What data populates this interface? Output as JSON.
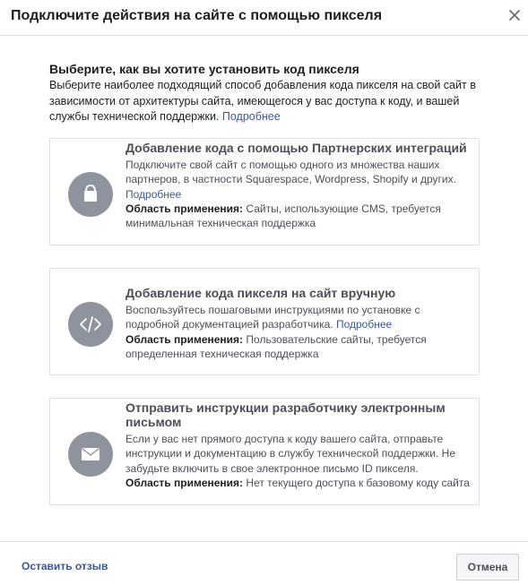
{
  "dialog": {
    "title": "Подключите действия на сайте с помощью пикселя",
    "close_icon": "close-icon"
  },
  "intro": {
    "heading": "Выберите, как вы хотите установить код пикселя",
    "text": "Выберите наиболее подходящий способ добавления кода пикселя на свой сайт в зависимости от архитектуры сайта, имеющегося у вас доступа к коду, и вашей службы технической поддержки.",
    "link": "Подробнее"
  },
  "options": [
    {
      "icon": "shopping-bag-icon",
      "title": "Добавление кода с помощью Партнерских интеграций",
      "description": "Подключите свой сайт с помощью одного из множества наших партнеров, в частности Squarespace, Wordpress, Shopify и других.",
      "link": "Подробнее",
      "scope_label": "Область применения:",
      "scope_text": "Сайты, использующие CMS, требуется минимальная техническая поддержка"
    },
    {
      "icon": "code-icon",
      "title": "Добавление кода пикселя на сайт вручную",
      "description": "Воспользуйтесь пошаговыми инструкциями по установке с подробной документацией разработчика.",
      "link": "Подробнее",
      "scope_label": "Область применения:",
      "scope_text": "Пользовательские сайты, требуется определенная техническая поддержка"
    },
    {
      "icon": "envelope-icon",
      "title": "Отправить инструкции разработчику электронным письмом",
      "description": "Если у вас нет прямого доступа к коду вашего сайта, отправьте инструкции и документацию в службу технической поддержки. Не забудьте включить в свое электронное письмо ID пикселя.",
      "scope_label": "Область применения:",
      "scope_text": "Нет текущего доступа к базовому коду сайта"
    }
  ],
  "footer": {
    "feedback_label": "Оставить отзыв",
    "cancel_label": "Отмена"
  }
}
